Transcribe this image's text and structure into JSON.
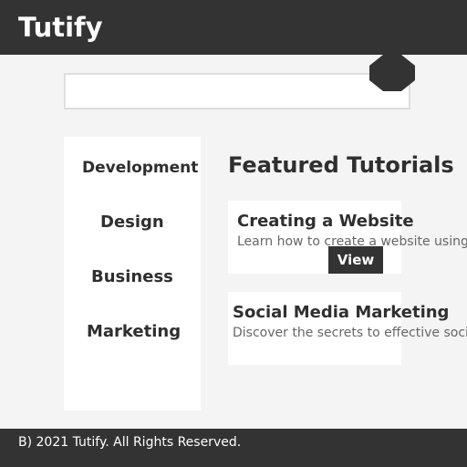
{
  "header": {
    "brand": "Tutify"
  },
  "search": {
    "placeholder": ""
  },
  "sidebar": {
    "items": [
      {
        "label": "Development"
      },
      {
        "label": "Design"
      },
      {
        "label": "Business"
      },
      {
        "label": "Marketing"
      }
    ]
  },
  "main": {
    "section_title": "Featured Tutorials",
    "cards": [
      {
        "title": "Creating a Website",
        "description": "Learn how to create a website using",
        "button_label": "View"
      },
      {
        "title": "Social Media Marketing",
        "description": "Discover the secrets to effective soci"
      }
    ]
  },
  "footer": {
    "text": "B) 2021 Tutify. All Rights Reserved."
  },
  "colors": {
    "header_bg": "#333333",
    "page_bg": "#f4f4f4",
    "panel_bg": "#ffffff",
    "text": "#2f2f2f",
    "muted_text": "#666666"
  }
}
